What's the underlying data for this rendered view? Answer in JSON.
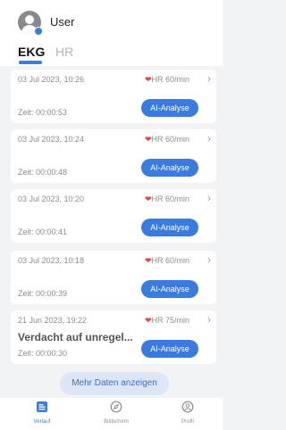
{
  "header": {
    "username": "User",
    "tabs": [
      {
        "label": "EKG",
        "active": true
      },
      {
        "label": "HR",
        "active": false
      }
    ]
  },
  "records": [
    {
      "date": "03 Jul 2023, 10:26",
      "hr": "HR 60/min",
      "message": "",
      "time": "Zeit: 00:00:53",
      "action": "AI-Analyse"
    },
    {
      "date": "03 Jul 2023, 10:24",
      "hr": "HR 60/min",
      "message": "",
      "time": "Zeit: 00:00:48",
      "action": "AI-Analyse"
    },
    {
      "date": "03 Jul 2023, 10:20",
      "hr": "HR 60/min",
      "message": "",
      "time": "Zeit: 00:00:41",
      "action": "AI-Analyse"
    },
    {
      "date": "03 Jul 2023, 10:18",
      "hr": "HR 60/min",
      "message": "",
      "time": "Zeit: 00:00:39",
      "action": "AI-Analyse"
    },
    {
      "date": "21 Jun 2023, 19:22",
      "hr": "HR 75/min",
      "message": "Verdacht auf unregel...",
      "time": "Zeit: 00:00:30",
      "action": "AI-Analyse"
    }
  ],
  "more_button": "Mehr Daten anzeigen",
  "bottom_nav": [
    {
      "label": "Verlauf",
      "icon": "list-icon",
      "active": true
    },
    {
      "label": "Bildschirm",
      "icon": "compass-icon",
      "active": false
    },
    {
      "label": "Profil",
      "icon": "profile-icon",
      "active": false
    }
  ],
  "colors": {
    "accent": "#3a7be0",
    "heart": "#e0484f",
    "background": "#f2f3f5"
  }
}
